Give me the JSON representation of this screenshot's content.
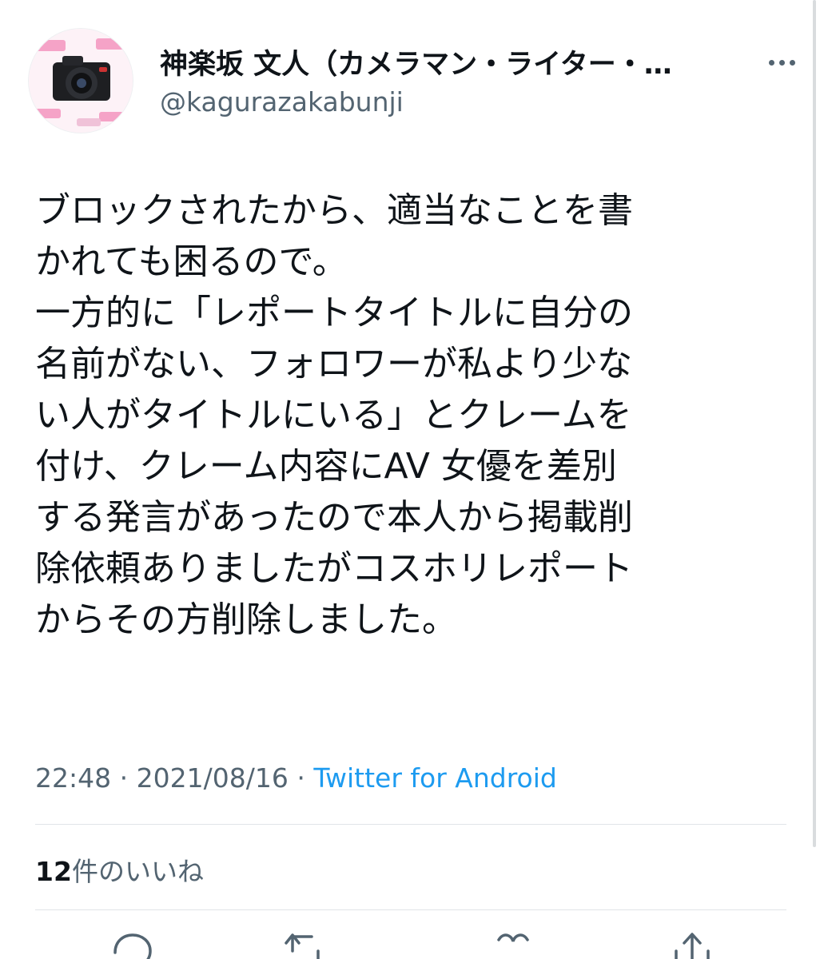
{
  "author": {
    "name": "神楽坂 文人（カメラマン・ライター・…",
    "handle": "@kagurazakabunji"
  },
  "tweet": {
    "lines": [
      "ブロックされたから、適当なことを書",
      "かれても困るので。",
      "一方的に「レポートタイトルに自分の",
      "名前がない、フォロワーが私より少な",
      "い人がタイトルにいる」とクレームを",
      "付け、クレーム内容にAV 女優を差別",
      "する発言があったので本人から掲載削",
      "除依頼ありましたがコスホリレポート",
      "からその方削除しました。"
    ],
    "time": "22:48",
    "separator": "·",
    "date": "2021/08/16",
    "source": "Twitter for Android"
  },
  "likes": {
    "count": "12",
    "label": "件のいいね"
  },
  "icons": {
    "more": "more-icon",
    "reply": "reply-icon",
    "retweet": "retweet-icon",
    "like": "like-icon",
    "share": "share-icon"
  },
  "colors": {
    "text": "#0f1419",
    "secondary": "#536471",
    "link": "#1d9bf0",
    "avatar_accent": "#e8488f"
  }
}
